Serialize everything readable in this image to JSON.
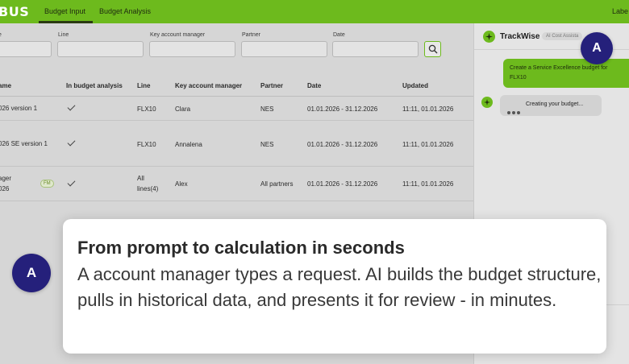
{
  "app": {
    "logo": "BUS",
    "tabs": [
      {
        "label": "Budget Input"
      },
      {
        "label": "Budget Analysis"
      }
    ],
    "top_right": "Labe"
  },
  "filters": [
    {
      "label": "e",
      "value": "",
      "placeholder": ""
    },
    {
      "label": "Line",
      "value": "",
      "placeholder": ""
    },
    {
      "label": "Key account manager",
      "value": "",
      "placeholder": ""
    },
    {
      "label": "Partner",
      "value": "",
      "placeholder": ""
    },
    {
      "label": "Date",
      "value": "",
      "placeholder": ""
    }
  ],
  "table": {
    "columns": [
      "ame",
      "In budget analysis",
      "Line",
      "Key account manager",
      "Partner",
      "Date",
      "Updated"
    ],
    "rows": [
      {
        "name": "026 version 1",
        "in_analysis": true,
        "line": "FLX10",
        "kam": "Clara",
        "partner": "NES",
        "date": "01.01.2026 - 31.12.2026",
        "updated": "11:11, 01.01.2026"
      },
      {
        "name": "026 SE version 1",
        "in_analysis": true,
        "line": "FLX10",
        "kam": "Annalena",
        "partner": "NES",
        "date": "01.01.2026 - 31.12.2026",
        "updated": "11:11, 01.01.2026"
      },
      {
        "name": "ager",
        "name2": "026",
        "badge": "FM",
        "in_analysis": true,
        "line": "All",
        "line2": "lines(4)",
        "kam": "Alex",
        "partner": "All partners",
        "date": "01.01.2026 - 31.12.2026",
        "updated": "11:11, 01.01.2026"
      }
    ]
  },
  "panel": {
    "title": "TrackWise",
    "badge": "AI Cost Assista",
    "user_message": "Create a Service Excellence budget for FLX10",
    "ai_message": "Creating your budget..."
  },
  "markers": {
    "top": "A",
    "card": "A"
  },
  "card": {
    "title": "From prompt to calculation in seconds",
    "body": "A account manager types a request. AI builds the budget structure, pulls in historical data, and presents it for review - in minutes."
  },
  "colors": {
    "brand_green": "#6dba1d",
    "marker_navy": "#25207b"
  }
}
